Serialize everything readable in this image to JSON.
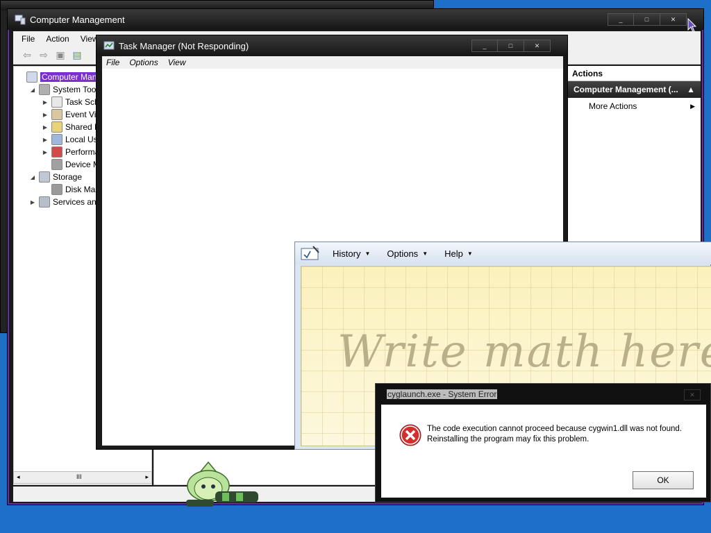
{
  "computer_management": {
    "title": "Computer Management",
    "menu": [
      "File",
      "Action",
      "View"
    ],
    "tree": [
      {
        "label": "Computer Manag",
        "level": 0,
        "expander": "",
        "icon": "computer-icon",
        "selected": true
      },
      {
        "label": "System Tools",
        "level": 1,
        "expander": "down",
        "icon": "tools-icon"
      },
      {
        "label": "Task Sche",
        "level": 2,
        "expander": "right",
        "icon": "clock-icon"
      },
      {
        "label": "Event View",
        "level": 2,
        "expander": "right",
        "icon": "event-viewer-icon"
      },
      {
        "label": "Shared Fo",
        "level": 2,
        "expander": "right",
        "icon": "shared-folder-icon"
      },
      {
        "label": "Local User",
        "level": 2,
        "expander": "right",
        "icon": "users-icon"
      },
      {
        "label": "Performan",
        "level": 2,
        "expander": "right",
        "icon": "performance-icon"
      },
      {
        "label": "Device Ma",
        "level": 2,
        "expander": "",
        "icon": "device-manager-icon"
      },
      {
        "label": "Storage",
        "level": 1,
        "expander": "down",
        "icon": "storage-icon"
      },
      {
        "label": "Disk Mana",
        "level": 2,
        "expander": "",
        "icon": "disk-icon"
      },
      {
        "label": "Services and A",
        "level": 1,
        "expander": "right",
        "icon": "services-icon"
      }
    ],
    "scroll_thumb": "III",
    "actions": {
      "header": "Actions",
      "section": "Computer Management (...",
      "more": "More Actions"
    }
  },
  "task_manager": {
    "title": "Task Manager (Not Responding)",
    "menu": [
      "File",
      "Options",
      "View"
    ]
  },
  "math_panel": {
    "menu": [
      "History",
      "Options",
      "Help"
    ],
    "hint": "Write math here"
  },
  "error_dialog": {
    "title": "cyglaunch.exe - System Error",
    "line1": "The code execution cannot proceed because cygwin1.dll was not found.",
    "line2": "Reinstalling the program may fix this problem.",
    "ok": "OK"
  },
  "colors": {
    "desktop": "#1e6fc7",
    "accent_purple": "#7a2fd0",
    "error_red": "#d32f2f"
  }
}
